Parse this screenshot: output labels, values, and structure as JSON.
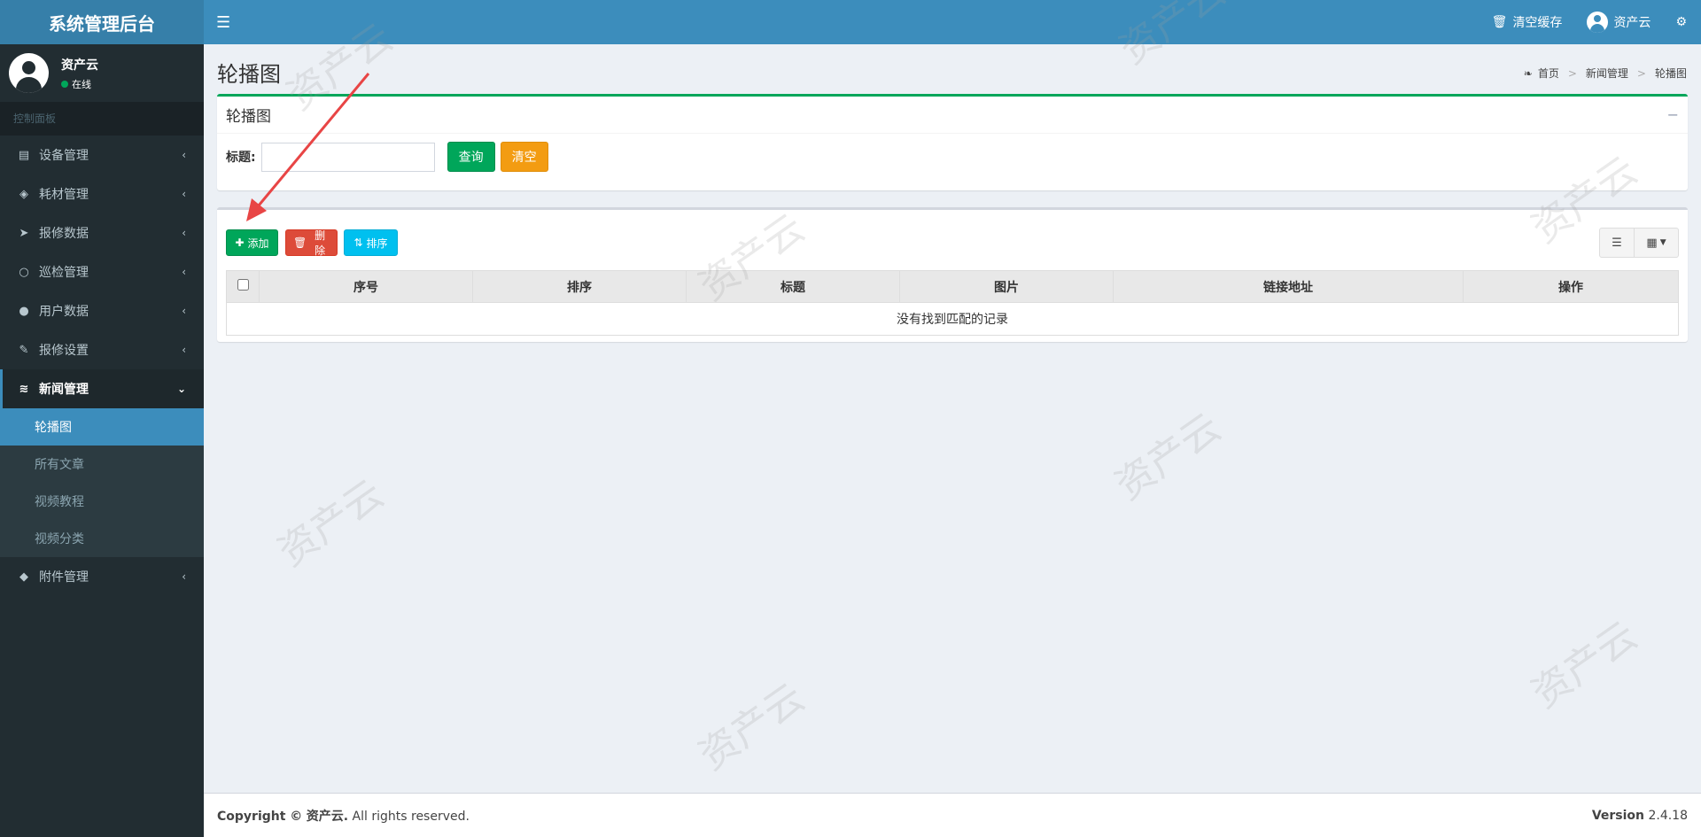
{
  "header": {
    "logo": "系统管理后台",
    "clear_cache": "清空缓存",
    "username": "资产云"
  },
  "sidebar": {
    "user_name": "资产云",
    "user_status": "在线",
    "section_label": "控制面板",
    "items": [
      {
        "label": "设备管理",
        "icon": "database-icon"
      },
      {
        "label": "耗材管理",
        "icon": "cube-icon"
      },
      {
        "label": "报修数据",
        "icon": "paper-plane-icon"
      },
      {
        "label": "巡检管理",
        "icon": "circle-icon"
      },
      {
        "label": "用户数据",
        "icon": "user-icon"
      },
      {
        "label": "报修设置",
        "icon": "wrench-icon"
      },
      {
        "label": "新闻管理",
        "icon": "rss-icon"
      },
      {
        "label": "附件管理",
        "icon": "tags-icon"
      }
    ],
    "submenu": [
      "轮播图",
      "所有文章",
      "视频教程",
      "视频分类"
    ]
  },
  "content": {
    "page_title": "轮播图",
    "breadcrumb": [
      "首页",
      "新闻管理",
      "轮播图"
    ],
    "search_box": {
      "title": "轮播图",
      "field_label": "标题:",
      "field_value": "",
      "query_btn": "查询",
      "clear_btn": "清空"
    },
    "toolbar": {
      "add": "添加",
      "delete": "删除",
      "sort": "排序"
    },
    "table": {
      "columns": [
        "序号",
        "排序",
        "标题",
        "图片",
        "链接地址",
        "操作"
      ],
      "empty_text": "没有找到匹配的记录"
    }
  },
  "footer": {
    "copyright_prefix": "Copyright ©",
    "company": "资产云.",
    "rights": "All rights reserved.",
    "version_label": "Version",
    "version": "2.4.18"
  },
  "watermark": "资产云",
  "colors": {
    "header": "#3c8dbc",
    "logo_bg": "#367fa9",
    "sidebar": "#222d32",
    "active_sub": "#3c8dbc",
    "green": "#00a65a",
    "orange": "#f39c12",
    "red": "#dd4b39",
    "cyan": "#00c0ef",
    "arrow": "#e84545"
  }
}
